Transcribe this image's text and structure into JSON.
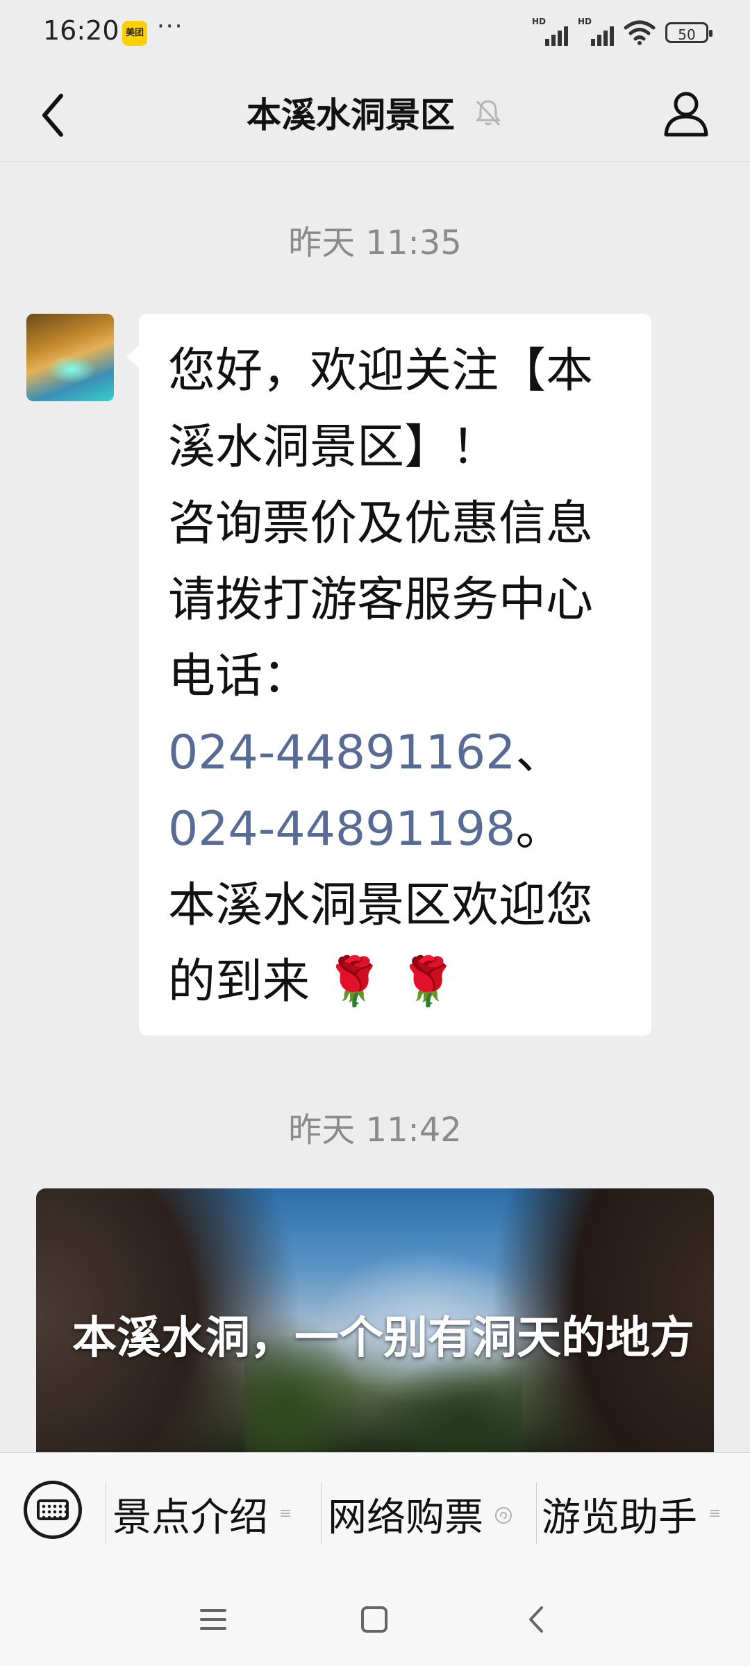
{
  "status": {
    "time": "16:20",
    "app_badge": "美团",
    "dots": "···",
    "sig1": "HD",
    "sig2": "HD",
    "battery": "50"
  },
  "header": {
    "title": "本溪水洞景区"
  },
  "chat": {
    "ts1": "昨天 11:35",
    "message": {
      "l1": "您好，欢迎关注【本",
      "l2": "溪水洞景区】！",
      "l3": "咨询票价及优惠信息",
      "l4": "请拨打游客服务中心",
      "l5": "电话：",
      "phone1": "024-44891162",
      "sep1": "、",
      "phone2": "024-44891198",
      "sep2": "。",
      "l8": "本溪水洞景区欢迎您",
      "l9": "的到来",
      "emoji": "🌹 🌹"
    },
    "ts2": "昨天 11:42",
    "article": {
      "title": "本溪水洞，一个别有洞天的地方"
    }
  },
  "menu": {
    "items": [
      {
        "label": "景点介绍"
      },
      {
        "label": "网络购票"
      },
      {
        "label": "游览助手"
      }
    ]
  }
}
